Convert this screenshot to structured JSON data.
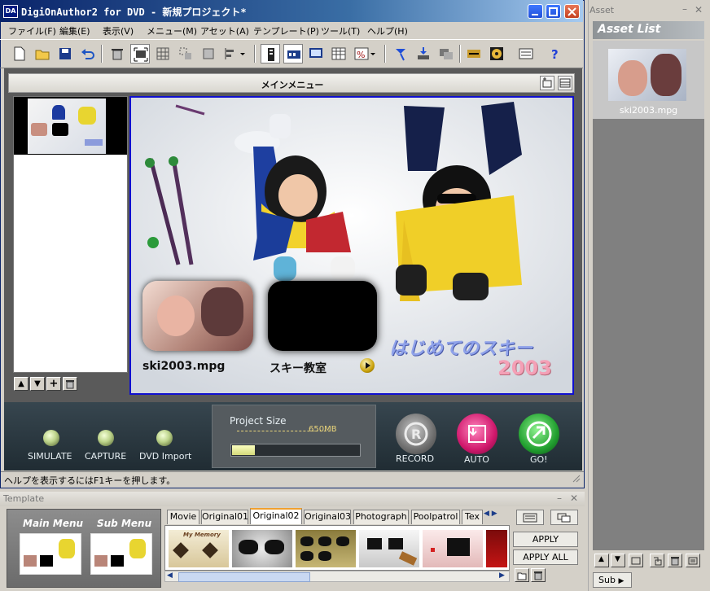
{
  "window": {
    "title": "DigiOnAuthor2 for DVD - 新規プロジェクト*",
    "menus": [
      "ファイル(F)",
      "編集(E)",
      "表示(V)",
      "メニュー(M)",
      "アセット(A)",
      "テンプレート(P)",
      "ツール(T)",
      "ヘルプ(H)"
    ]
  },
  "editor": {
    "menu_header": "メインメニュー",
    "canvas": {
      "button1_label": "ski2003.mpg",
      "button2_label": "スキー教室",
      "title_text": "はじめてのスキー",
      "year_text": "2003"
    }
  },
  "control_panel": {
    "simulate": "SIMULATE",
    "capture": "CAPTURE",
    "dvd_import": "DVD Import",
    "project_size_label": "Project Size",
    "size_mark": "650MB",
    "project_size_fill": 0.18,
    "record": "RECORD",
    "auto": "AUTO",
    "go": "GO!"
  },
  "status": {
    "help": "ヘルプを表示するにはF1キーを押します。"
  },
  "template_panel": {
    "title": "Template",
    "main_menu": "Main Menu",
    "sub_menu": "Sub Menu",
    "tabs": [
      "Movie",
      "Original01",
      "Original02",
      "Original03",
      "Photograph",
      "Poolpatrol",
      "Tex"
    ],
    "active_tab": "Original02",
    "apply": "APPLY",
    "apply_all": "APPLY ALL",
    "thumb1_text": "My Memory"
  },
  "asset_panel": {
    "header": "Asset",
    "list_title": "Asset List",
    "item": "ski2003.mpg",
    "sub_button": "Sub"
  },
  "colors": {
    "titlebar": "#0a246a",
    "canvas_border": "#1010d0",
    "title_text": "#8fa2ea",
    "year_text": "#f4a0b6",
    "record": "#6f6f6f",
    "auto": "#d0186c",
    "go": "#22a030"
  }
}
